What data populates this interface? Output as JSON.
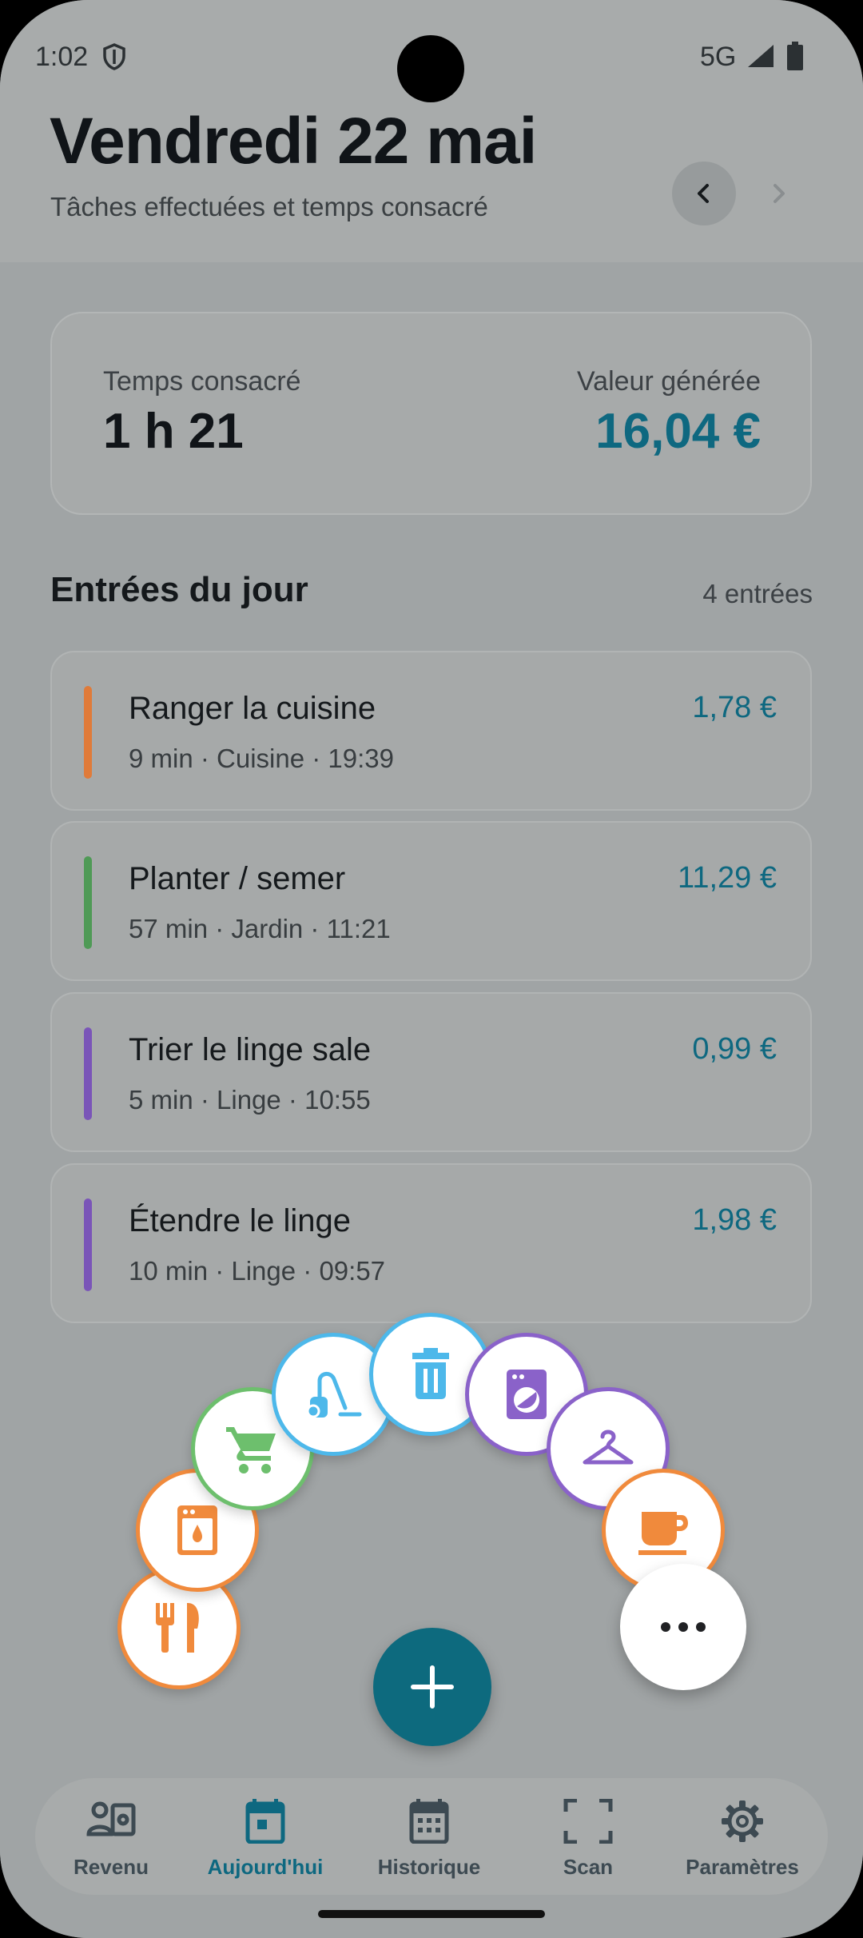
{
  "status_bar": {
    "time": "1:02",
    "network": "5G"
  },
  "header": {
    "title": "Vendredi 22 mai",
    "subtitle": "Tâches effectuées et temps consacré"
  },
  "summary": {
    "time_label": "Temps consacré",
    "time_value": "1 h 21",
    "value_label": "Valeur générée",
    "value_amount": "16,04 €"
  },
  "entries_section": {
    "title": "Entrées du jour",
    "count": "4 entrées",
    "items": [
      {
        "title": "Ranger la cuisine",
        "meta": "9 min · Cuisine · 19:39",
        "value": "1,78 €",
        "color": "#e07b3a"
      },
      {
        "title": "Planter / semer",
        "meta": "57 min · Jardin · 11:21",
        "value": "11,29 €",
        "color": "#4f9a56"
      },
      {
        "title": "Trier le linge sale",
        "meta": "5 min · Linge · 10:55",
        "value": "0,99 €",
        "color": "#7a55b8"
      },
      {
        "title": "Étendre le linge",
        "meta": "10 min · Linge · 09:57",
        "value": "1,98 €",
        "color": "#7a55b8"
      }
    ]
  },
  "quick_actions": [
    {
      "icon": "cutlery-icon",
      "color": "#f08a3c"
    },
    {
      "icon": "dishwasher-icon",
      "color": "#f08a3c"
    },
    {
      "icon": "shopping-cart-icon",
      "color": "#6dbf6d"
    },
    {
      "icon": "vacuum-cleaner-icon",
      "color": "#4db8ea"
    },
    {
      "icon": "trash-can-icon",
      "color": "#4db8ea"
    },
    {
      "icon": "washing-machine-icon",
      "color": "#8a62c9"
    },
    {
      "icon": "clothes-hanger-icon",
      "color": "#8a62c9"
    },
    {
      "icon": "coffee-cup-icon",
      "color": "#f08a3c"
    },
    {
      "icon": "more-horizontal-icon",
      "color": "#202124"
    }
  ],
  "bottom_nav": {
    "items": [
      {
        "label": "Revenu",
        "icon": "income-icon"
      },
      {
        "label": "Aujourd'hui",
        "icon": "calendar-today-icon",
        "active": true
      },
      {
        "label": "Historique",
        "icon": "calendar-month-icon"
      },
      {
        "label": "Scan",
        "icon": "scan-icon"
      },
      {
        "label": "Paramètres",
        "icon": "gear-icon"
      }
    ]
  },
  "colors": {
    "accent": "#0e6880",
    "fab": "#0d6a7e"
  }
}
